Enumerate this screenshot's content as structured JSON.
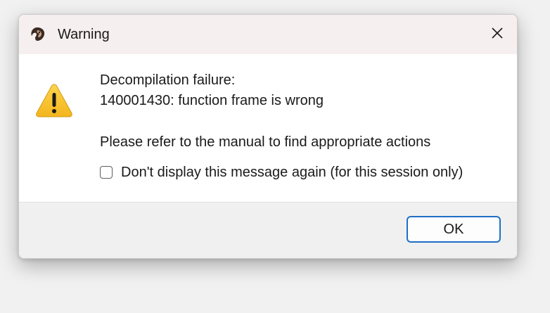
{
  "window": {
    "title": "Warning",
    "app_icon": "ida-app-icon",
    "close_icon": "close-icon"
  },
  "message": {
    "icon": "warning-icon",
    "line1": "Decompilation failure:",
    "line2": "140001430: function frame is wrong",
    "line3": "Please refer to the manual to find appropriate actions"
  },
  "checkbox": {
    "label": "Don't display this message again (for this session only)",
    "checked": false
  },
  "footer": {
    "ok_label": "OK"
  },
  "colors": {
    "accent": "#1f6fc8",
    "warning_fill": "#f6c33c",
    "titlebar_bg": "#f6efef"
  }
}
